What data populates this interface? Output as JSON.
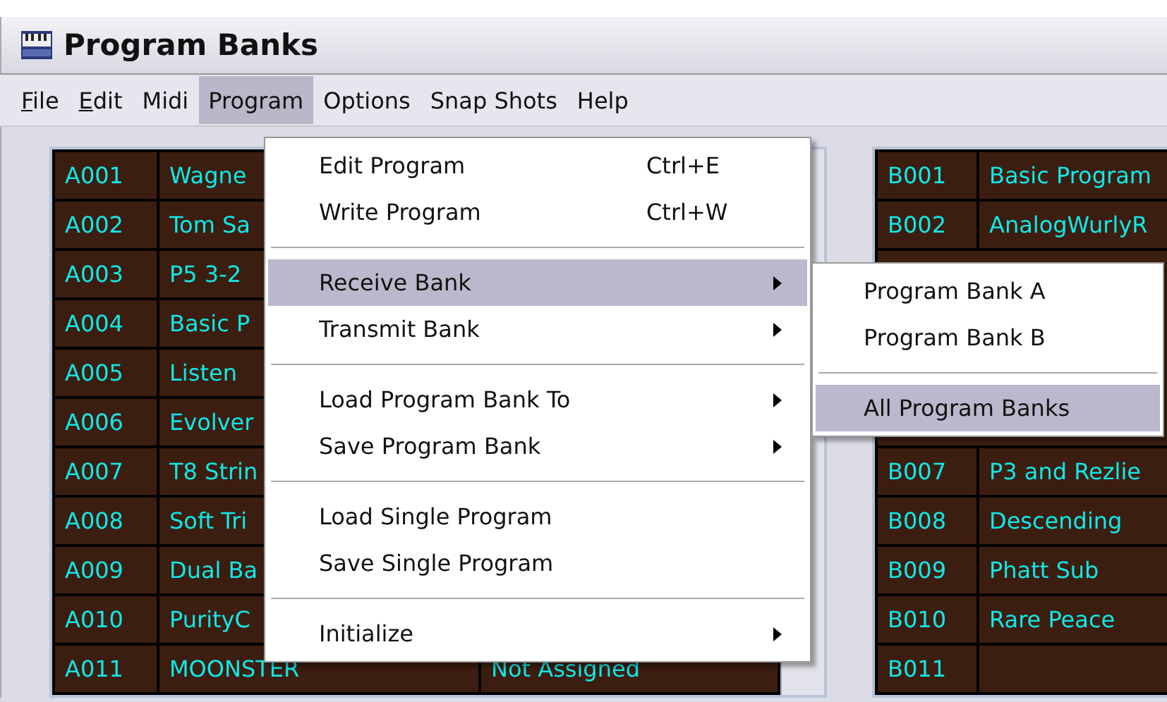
{
  "window": {
    "title": "Program Banks"
  },
  "menubar": [
    {
      "label": "File",
      "mnemonic_underlined": true,
      "selected": false
    },
    {
      "label": "Edit",
      "mnemonic_underlined": true,
      "selected": false
    },
    {
      "label": "Midi",
      "mnemonic_underlined": false,
      "selected": false
    },
    {
      "label": "Program",
      "mnemonic_underlined": false,
      "selected": true
    },
    {
      "label": "Options",
      "mnemonic_underlined": false,
      "selected": false
    },
    {
      "label": "Snap Shots",
      "mnemonic_underlined": false,
      "selected": false
    },
    {
      "label": "Help",
      "mnemonic_underlined": false,
      "selected": false
    }
  ],
  "bank_a": {
    "rows": [
      {
        "number": "A001",
        "name": "Wagne"
      },
      {
        "number": "A002",
        "name": "Tom Sa"
      },
      {
        "number": "A003",
        "name": "P5 3-2"
      },
      {
        "number": "A004",
        "name": "Basic P"
      },
      {
        "number": "A005",
        "name": "Listen"
      },
      {
        "number": "A006",
        "name": "Evolver"
      },
      {
        "number": "A007",
        "name": "T8 Strin"
      },
      {
        "number": "A008",
        "name": "Soft Tri"
      },
      {
        "number": "A009",
        "name": "Dual Ba"
      },
      {
        "number": "A010",
        "name": "PurityC"
      },
      {
        "number": "A011",
        "name": "MOONSTER",
        "column_3": "Not Assigned"
      }
    ]
  },
  "bank_b": {
    "rows_above_submenu": [
      {
        "number": "B001",
        "name": "Basic Program"
      },
      {
        "number": "B002",
        "name": "AnalogWurlyR"
      }
    ],
    "rows_below_submenu": [
      {
        "number": "B007",
        "name": "P3 and Rezlie"
      },
      {
        "number": "B008",
        "name": "Descending"
      },
      {
        "number": "B009",
        "name": "Phatt Sub"
      },
      {
        "number": "B010",
        "name": "Rare Peace"
      },
      {
        "number": "B011"
      }
    ]
  },
  "program_menu": [
    {
      "kind": "item",
      "label": "Edit Program",
      "shortcut": "Ctrl+E",
      "submenu": false,
      "selected": false
    },
    {
      "kind": "item",
      "label": "Write Program",
      "shortcut": "Ctrl+W",
      "submenu": false,
      "selected": false
    },
    {
      "kind": "separator"
    },
    {
      "kind": "item",
      "label": "Receive Bank",
      "submenu": true,
      "selected": true
    },
    {
      "kind": "item",
      "label": "Transmit Bank",
      "submenu": true,
      "selected": false
    },
    {
      "kind": "separator"
    },
    {
      "kind": "item",
      "label": "Load Program Bank To",
      "submenu": true,
      "selected": false
    },
    {
      "kind": "item",
      "label": "Save Program Bank",
      "submenu": true,
      "selected": false
    },
    {
      "kind": "separator"
    },
    {
      "kind": "item",
      "label": "Load Single Program",
      "submenu": false,
      "selected": false
    },
    {
      "kind": "item",
      "label": "Save Single Program",
      "submenu": false,
      "selected": false
    },
    {
      "kind": "separator"
    },
    {
      "kind": "item",
      "label": "Initialize",
      "submenu": true,
      "selected": false
    }
  ],
  "receive_submenu": [
    {
      "kind": "item",
      "label": "Program Bank A",
      "selected": false
    },
    {
      "kind": "item",
      "label": "Program Bank B",
      "selected": false
    },
    {
      "kind": "separator"
    },
    {
      "kind": "item",
      "label": "All Program Banks",
      "selected": true
    }
  ]
}
